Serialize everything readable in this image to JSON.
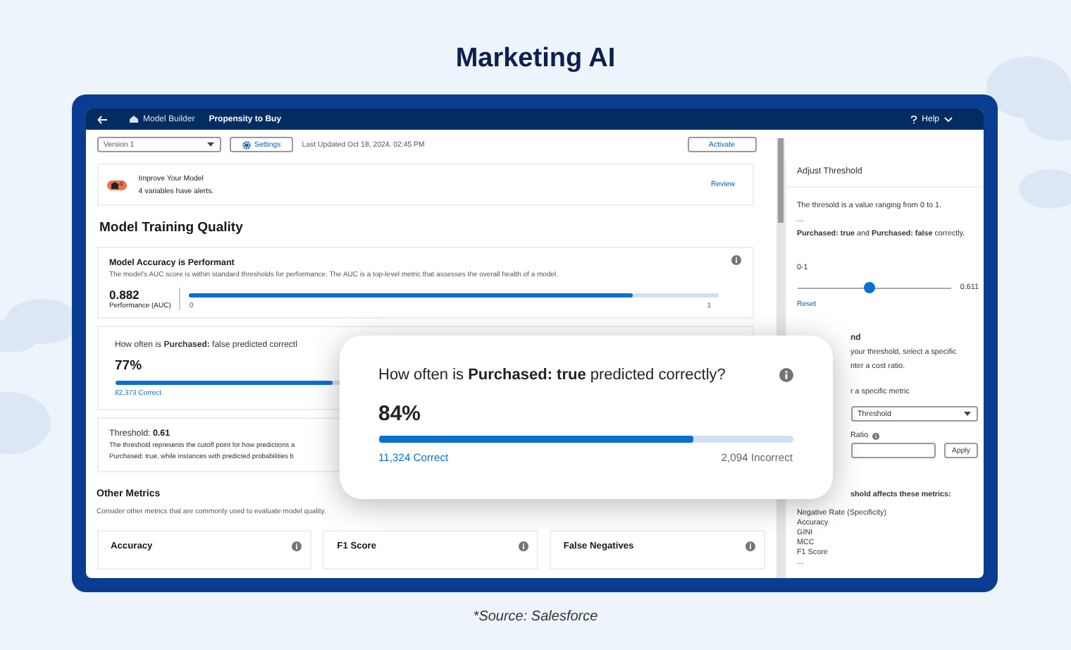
{
  "page": {
    "title": "Marketing AI",
    "caption": "*Source: Salesforce"
  },
  "header": {
    "breadcrumb": "Model Builder",
    "title": "Propensity to Buy",
    "help": "Help"
  },
  "toolbar": {
    "version": "Version 1",
    "settings": "Settings",
    "last_updated": "Last Updated Oct 18, 2024, 02:45 PM",
    "activate": "Activate"
  },
  "alert": {
    "count": "4",
    "title": "Improve Your Model",
    "message": "4 variables have alerts.",
    "action": "Review"
  },
  "section_title": "Model Training Quality",
  "accuracy_card": {
    "title": "Model Accuracy is Performant",
    "description": "The model's AUC score is within standard thresholds for performance. The AUC is a top-level metric that assesses the overall health of a model.",
    "score": "0.882",
    "score_label": "Performance (AUC)",
    "level": 0.84,
    "axis_min": "0",
    "axis_max": "1"
  },
  "false_card": {
    "question": "How often is **Purchased:** false predicted correctl",
    "percent": "77%",
    "level": 0.77,
    "correct": "82,373 Correct"
  },
  "threshold_card": {
    "label": "Threshold:",
    "value": "0.61",
    "lines": [
      "The threshold represents the cutoff point for how predictions a",
      "Purchased: true, while instances with predicted probabilities b"
    ]
  },
  "other_metrics": {
    "title": "Other Metrics",
    "description": "Consider other metrics that are commonly used to evaluate model quality.",
    "cards": [
      {
        "label": "Accuracy"
      },
      {
        "label": "F1 Score"
      },
      {
        "label": "False Negatives"
      }
    ]
  },
  "popup": {
    "question": "How often is **Purchased: true** predicted correctly?",
    "percent": "84%",
    "level": 0.76,
    "correct": "11,324 Correct",
    "incorrect": "2,094 Incorrect"
  },
  "side_panel": {
    "title": "Adjust Threshold",
    "intro": "The thresold is a value ranging from 0 to 1.",
    "ellipsis": "...",
    "note": "**Purchased: true** and **Purchased: false** correctly.",
    "range_label": "0-1",
    "level": 0.47,
    "value": "0.611",
    "reset": "Reset",
    "section_heading": "nd",
    "section_lines": [
      "your threshold, select a specific",
      "nter a cost ratio."
    ],
    "metric_label": "r a specific metric",
    "metric_select": "Threshold",
    "ratio_label": "Ratio",
    "apply": "Apply",
    "affects_heading": "shold affects these metrics:",
    "metrics": [
      "Negative Rate (Specificity)",
      "Accuracy",
      "GINI",
      "MCC",
      "F1 Score"
    ],
    "more": "..."
  }
}
